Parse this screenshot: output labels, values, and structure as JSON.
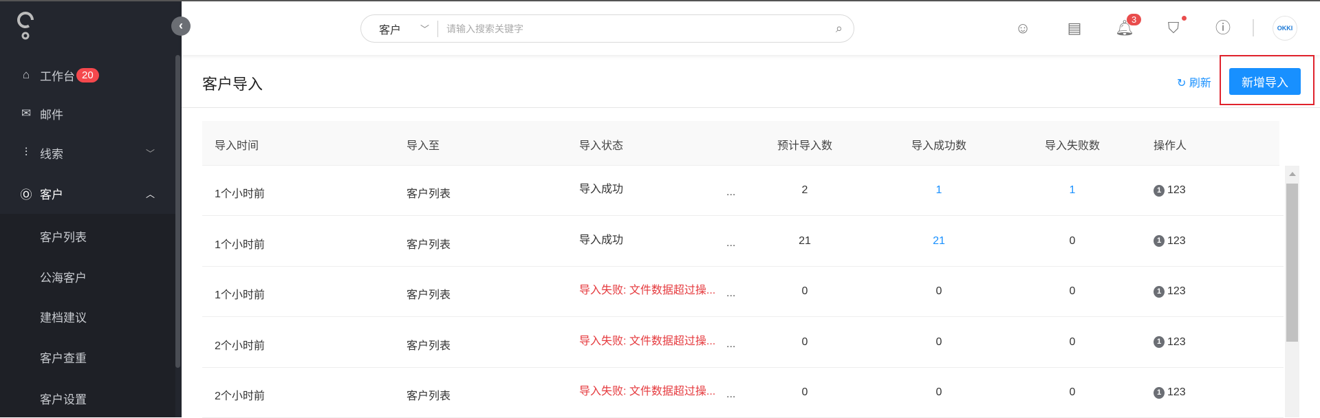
{
  "sidebar": {
    "items": [
      {
        "label": "工作台",
        "badge": "20",
        "icon": "home-icon"
      },
      {
        "label": "邮件",
        "icon": "mail-icon"
      },
      {
        "label": "线索",
        "icon": "leads-icon"
      },
      {
        "label": "客户",
        "icon": "customer-icon"
      }
    ],
    "sub_items": [
      "客户列表",
      "公海客户",
      "建档建议",
      "客户查重",
      "客户设置"
    ]
  },
  "header": {
    "search_category": "客户",
    "search_placeholder": "请输入搜索关键字",
    "notification_count": "3",
    "avatar_text": "OKKI"
  },
  "page": {
    "title": "客户导入",
    "refresh_label": "刷新",
    "add_label": "新增导入"
  },
  "table": {
    "columns": [
      "导入时间",
      "导入至",
      "导入状态",
      "预计导入数",
      "导入成功数",
      "导入失败数",
      "操作人"
    ],
    "more": "...",
    "rows": [
      {
        "time": "1个小时前",
        "target": "客户列表",
        "status": "导入成功",
        "expected": "2",
        "success": "1",
        "failed": "1",
        "operator": "123",
        "operator_icon": "1"
      },
      {
        "time": "1个小时前",
        "target": "客户列表",
        "status": "导入成功",
        "expected": "21",
        "success": "21",
        "failed": "0",
        "operator": "123",
        "operator_icon": "1"
      },
      {
        "time": "1个小时前",
        "target": "客户列表",
        "status": "导入失败: 文件数据超过操...",
        "expected": "0",
        "success": "0",
        "failed": "0",
        "operator": "123",
        "operator_icon": "1"
      },
      {
        "time": "2个小时前",
        "target": "客户列表",
        "status": "导入失败: 文件数据超过操...",
        "expected": "0",
        "success": "0",
        "failed": "0",
        "operator": "123",
        "operator_icon": "1"
      },
      {
        "time": "2个小时前",
        "target": "客户列表",
        "status": "导入失败: 文件数据超过操...",
        "expected": "0",
        "success": "0",
        "failed": "0",
        "operator": "123",
        "operator_icon": "1"
      }
    ]
  },
  "colors": {
    "accent": "#1890ff",
    "error": "#e5393d",
    "sidebar": "#23262e"
  }
}
